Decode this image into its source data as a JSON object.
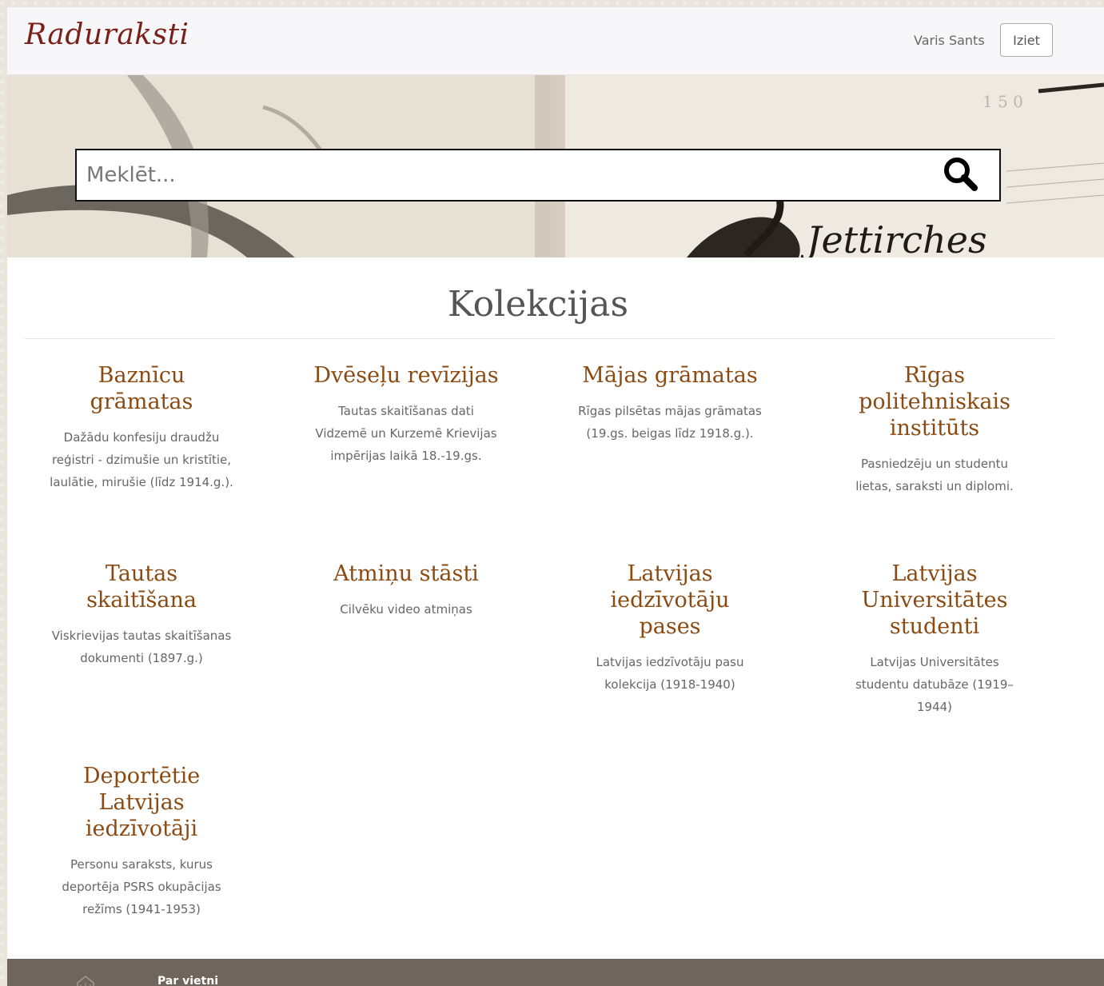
{
  "header": {
    "brand": "Raduraksti",
    "user_name": "Varis Sants",
    "logout_label": "Iziet"
  },
  "search": {
    "placeholder": "Meklēt..."
  },
  "main": {
    "section_title": "Kolekcijas",
    "collections": [
      {
        "title": "Baznīcu grāmatas",
        "description": "Dažādu konfesiju draudžu reģistri - dzimušie un kristītie, laulātie, mirušie (līdz 1914.g.)."
      },
      {
        "title": "Dvēseļu revīzijas",
        "description": "Tautas skaitīšanas dati Vidzemē un Kurzemē Krievijas impērijas laikā 18.-19.gs."
      },
      {
        "title": "Mājas grāmatas",
        "description": "Rīgas pilsētas mājas grāmatas (19.gs. beigas līdz 1918.g.)."
      },
      {
        "title": "Rīgas politehniskais institūts",
        "description": "Pasniedzēju un studentu lietas, saraksti un diplomi."
      },
      {
        "title": "Tautas skaitīšana",
        "description": "Viskrievijas tautas skaitīšanas dokumenti (1897.g.)"
      },
      {
        "title": "Atmiņu stāsti",
        "description": "Cilvēku video atmiņas"
      },
      {
        "title": "Latvijas iedzīvotāju pases",
        "description": "Latvijas iedzīvotāju pasu kolekcija (1918-1940)"
      },
      {
        "title": "Latvijas Universitātes studenti",
        "description": "Latvijas Universitātes studentu datubāze (1919–1944)"
      },
      {
        "title": "Deportētie Latvijas iedzīvotāji",
        "description": "Personu saraksts, kurus deportēja PSRS okupācijas režīms (1941-1953)"
      }
    ]
  },
  "footer": {
    "about_link": "Par vietni"
  }
}
